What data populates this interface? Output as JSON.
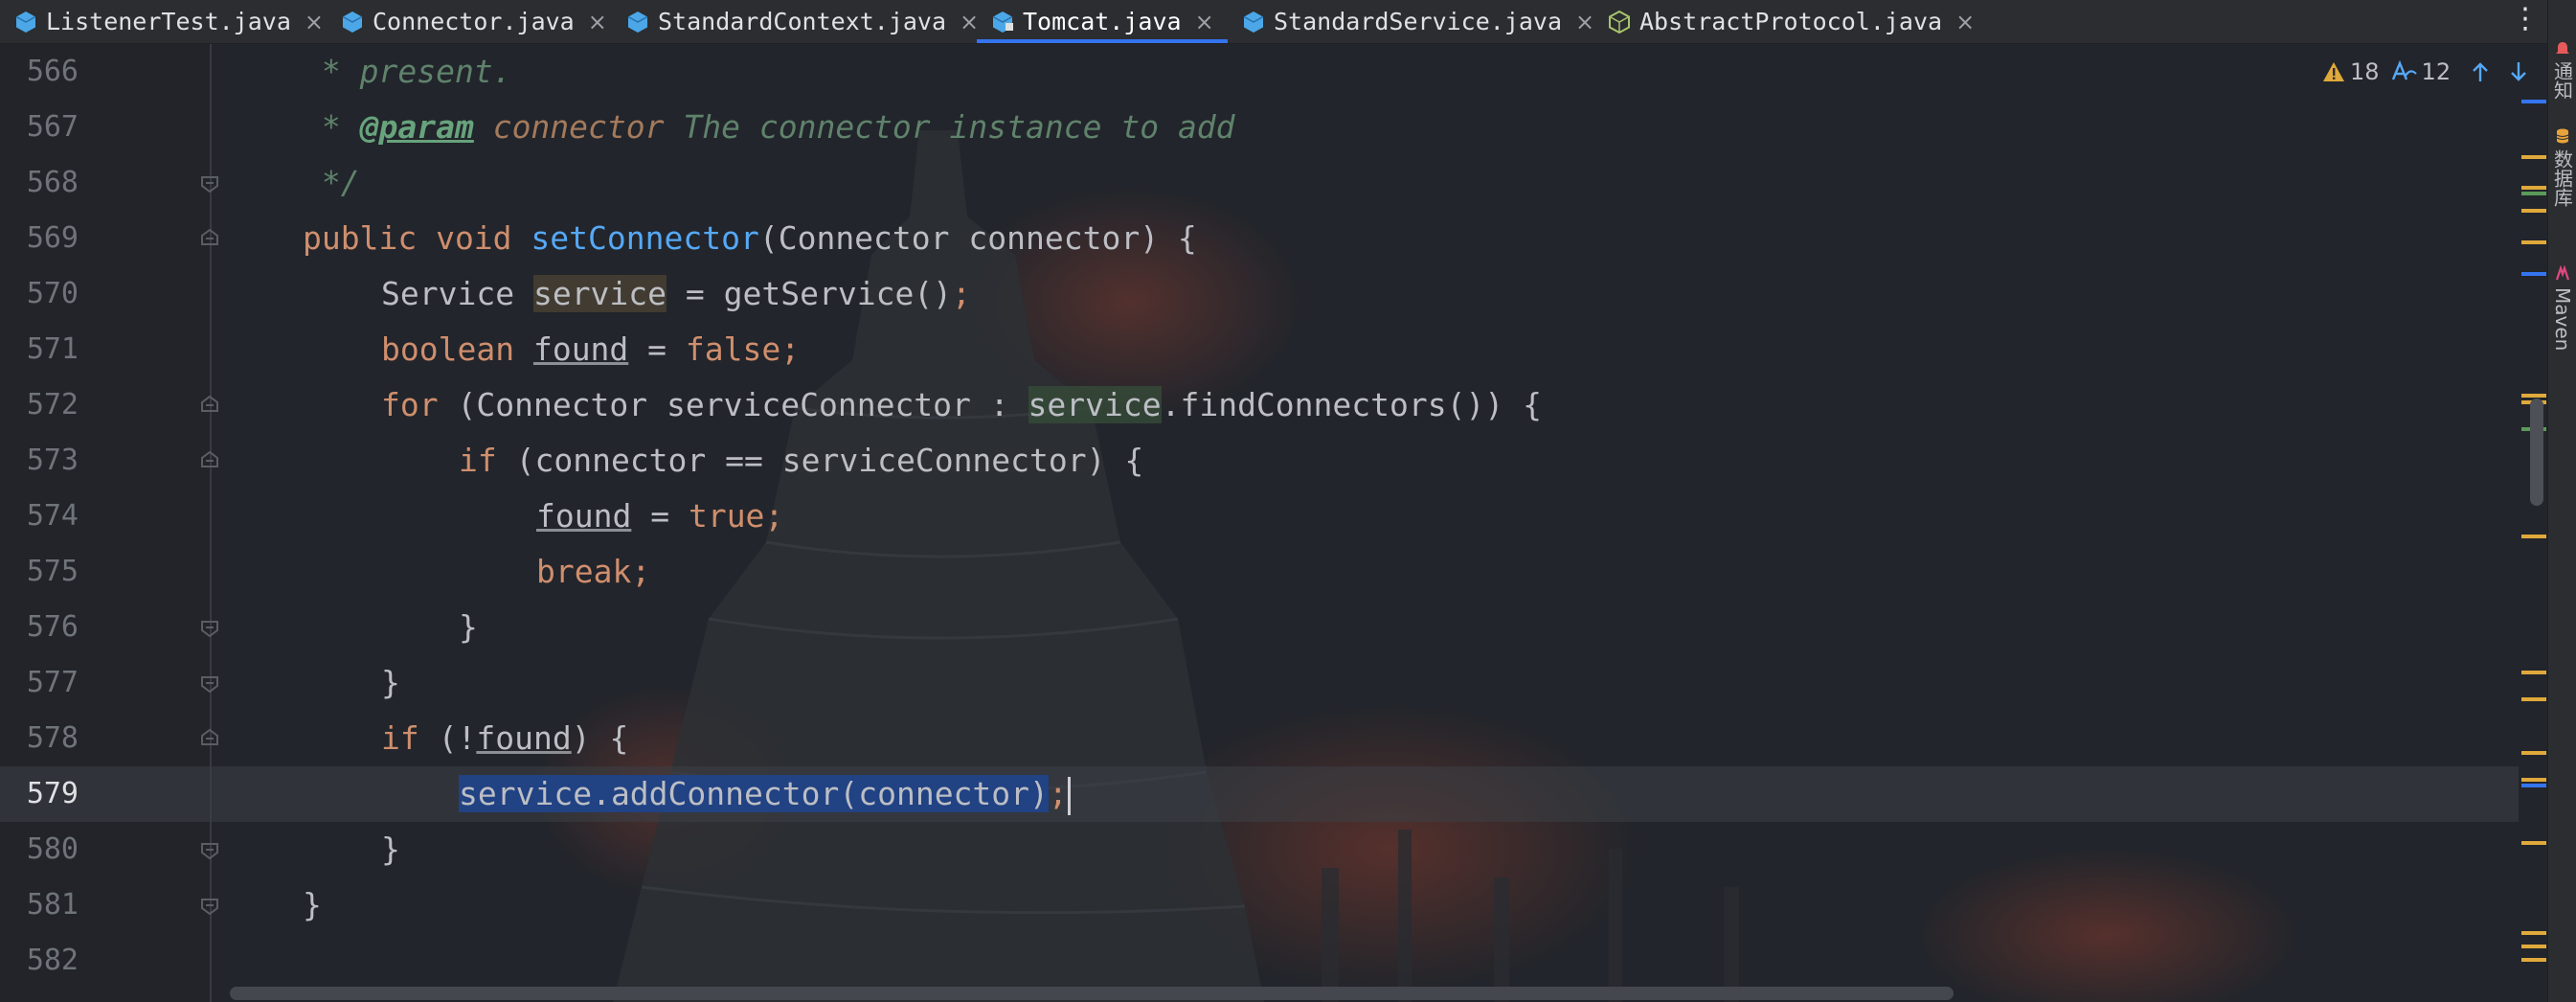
{
  "tabs": [
    {
      "label": "ListenerTest.java",
      "icon": "java-class-icon",
      "active": false
    },
    {
      "label": "Connector.java",
      "icon": "java-class-icon",
      "active": false
    },
    {
      "label": "StandardContext.java",
      "icon": "java-class-icon",
      "active": false
    },
    {
      "label": "Tomcat.java",
      "icon": "java-class-icon",
      "active": true
    },
    {
      "label": "StandardService.java",
      "icon": "java-class-icon",
      "active": false
    },
    {
      "label": "AbstractProtocol.java",
      "icon": "java-abstract-class-icon",
      "active": false
    }
  ],
  "tab_close_glyph": "×",
  "tab_menu_glyph": "⋮",
  "inspections": {
    "warnings": "18",
    "weak_warnings": "12"
  },
  "side_panels": [
    {
      "label": "通知",
      "icon": "notifications-icon"
    },
    {
      "label": "数据库",
      "icon": "database-icon"
    },
    {
      "label": "Maven",
      "icon": "maven-icon"
    }
  ],
  "code": {
    "current_line": "579",
    "lines": [
      {
        "n": "566",
        "text": " * present."
      },
      {
        "n": "567",
        "text": " * @param connector The connector instance to add"
      },
      {
        "n": "568",
        "text": " */"
      },
      {
        "n": "569",
        "text": "public void setConnector(Connector connector) {"
      },
      {
        "n": "570",
        "text": "Service service = getService();"
      },
      {
        "n": "571",
        "text": "boolean found = false;"
      },
      {
        "n": "572",
        "text": "for (Connector serviceConnector : service.findConnectors()) {"
      },
      {
        "n": "573",
        "text": "if (connector == serviceConnector) {"
      },
      {
        "n": "574",
        "text": "found = true;"
      },
      {
        "n": "575",
        "text": "break;"
      },
      {
        "n": "576",
        "text": "}"
      },
      {
        "n": "577",
        "text": "}"
      },
      {
        "n": "578",
        "text": "if (!found) {"
      },
      {
        "n": "579",
        "text": "service.addConnector(connector);"
      },
      {
        "n": "580",
        "text": "}"
      },
      {
        "n": "581",
        "text": "}"
      },
      {
        "n": "582",
        "text": ""
      }
    ]
  },
  "colors": {
    "keyword": "#cf8e6d",
    "method_decl": "#56a8f5",
    "doc_comment": "#5f826b",
    "selection": "#214283",
    "active_tab_underline": "#3574f0",
    "warning": "#e0a93b"
  }
}
